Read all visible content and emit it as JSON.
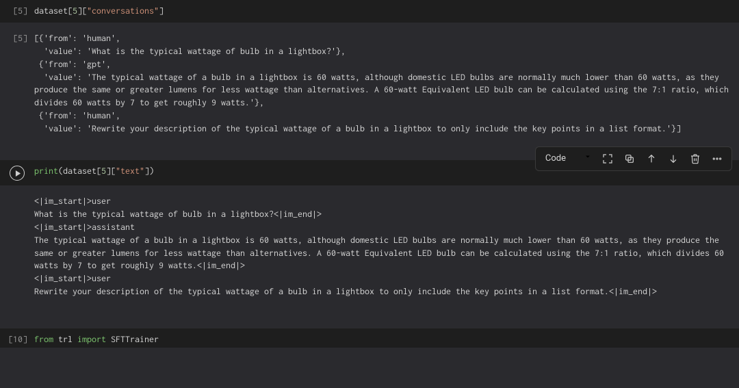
{
  "cells": [
    {
      "execution_count": "[5]",
      "code_tokens": {
        "var1": "dataset",
        "idx": "5",
        "key": "\"conversations\""
      },
      "output_label": "[5]",
      "output": "[{'from': 'human',\n  'value': 'What is the typical wattage of bulb in a lightbox?'},\n {'from': 'gpt',\n  'value': 'The typical wattage of a bulb in a lightbox is 60 watts, although domestic LED bulbs are normally much lower than 60 watts, as they produce the same or greater lumens for less wattage than alternatives. A 60-watt Equivalent LED bulb can be calculated using the 7:1 ratio, which divides 60 watts by 7 to get roughly 9 watts.'},\n {'from': 'human',\n  'value': 'Rewrite your description of the typical wattage of a bulb in a lightbox to only include the key points in a list format.'}]"
    },
    {
      "execution_running": true,
      "code_tokens": {
        "fn": "print",
        "var1": "dataset",
        "idx": "5",
        "key": "\"text\""
      },
      "output": "<|im_start|>user\nWhat is the typical wattage of bulb in a lightbox?<|im_end|>\n<|im_start|>assistant\nThe typical wattage of a bulb in a lightbox is 60 watts, although domestic LED bulbs are normally much lower than 60 watts, as they produce the same or greater lumens for less wattage than alternatives. A 60-watt Equivalent LED bulb can be calculated using the 7:1 ratio, which divides 60 watts by 7 to get roughly 9 watts.<|im_end|>\n<|im_start|>user\nRewrite your description of the typical wattage of a bulb in a lightbox to only include the key points in a list format.<|im_end|>"
    },
    {
      "execution_count": "[10]",
      "code_tokens": {
        "kw1": "from",
        "mod": "trl",
        "kw2": "import",
        "sym": "SFTTrainer"
      }
    }
  ],
  "toolbar": {
    "type_label": "Code"
  }
}
